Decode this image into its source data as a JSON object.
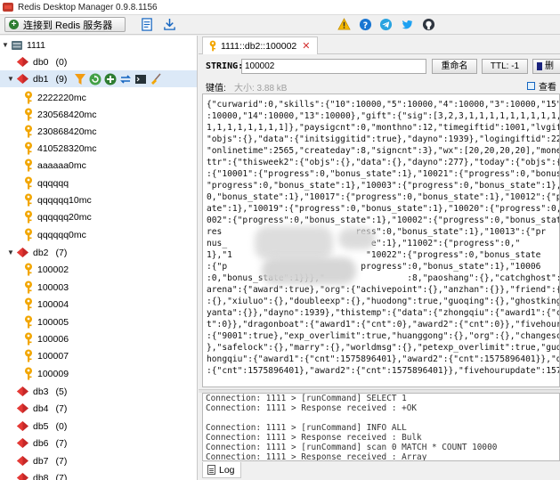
{
  "window": {
    "title": "Redis Desktop Manager 0.9.8.1156"
  },
  "toolbar": {
    "connect_label": "连接到 Redis 服务器",
    "icons": [
      "import-icon",
      "export-icon",
      "warning-icon",
      "help-icon",
      "telegram-icon",
      "twitter-icon",
      "github-icon"
    ]
  },
  "tree": {
    "server": {
      "name": "1111"
    },
    "databases_top": [
      {
        "name": "db0",
        "count": "(0)"
      },
      {
        "name": "db1",
        "count": "(9)"
      }
    ],
    "db1_keys": [
      "2222220mc",
      "230568420mc",
      "230868420mc",
      "410528320mc",
      "aaaaaa0mc",
      "qqqqqq",
      "qqqqqq10mc",
      "qqqqqq20mc",
      "qqqqqq0mc"
    ],
    "db2": {
      "name": "db2",
      "count": "(7)"
    },
    "db2_keys": [
      "100002",
      "100003",
      "100004",
      "100005",
      "100006",
      "100007",
      "100009"
    ],
    "databases_bottom": [
      {
        "name": "db3",
        "count": "(5)"
      },
      {
        "name": "db4",
        "count": "(7)"
      },
      {
        "name": "db5",
        "count": "(0)"
      },
      {
        "name": "db6",
        "count": "(7)"
      },
      {
        "name": "db7",
        "count": "(7)"
      },
      {
        "name": "db8",
        "count": "(7)"
      }
    ],
    "colors": {
      "db_icon": "#c62828",
      "key_icon": "#f2a600",
      "selected_row": "#dce9f7"
    }
  },
  "tab": {
    "label": "1111::db2::100002"
  },
  "key": {
    "type_label": "STRING:",
    "name": "100002",
    "rename_label": "重命名",
    "ttl_label": "TTL: -1",
    "delete_label": "删"
  },
  "value": {
    "label": "键值:",
    "size": "大小: 3.88 kB",
    "view_label": "查看",
    "lines": [
      "{\"curwarid\":0,\"skills\":{\"10\":10000,\"5\":10000,\"4\":10000,\"3\":10000,\"15\":1000",
      ":10000,\"14\":10000,\"13\":10000},\"gift\":{\"sig\":[3,2,3,1,1,1,1,1,1,1,1,1,1,1,",
      "1,1,1,1,1,1,1,1]},\"paysigcnt\":0,\"monthno\":12,\"timegiftid\":1001,\"lvgiftid\":2",
      "\"objs\":{},\"data\":{\"initsiggitid\":true},\"dayno\":1939},\"logingiftid\":2203,\"sig",
      "\"onlinetime\":2565,\"createday\":8,\"signcnt\":3},\"wx\":[20,20,20,20],\"money\":33",
      "ttr\":{\"thisweek2\":{\"objs\":{},\"data\":{},\"dayno\":277},\"today\":{\"objs\":{\"huodon",
      ":{\"10001\":{\"progress\":0,\"bonus_state\":1},\"10021\":{\"progress\":0,\"bonus_state\"",
      "\"progress\":0,\"bonus_state\":1},\"10003\":{\"progress\":0,\"bonus_state\":1},\"10014\"",
      "0,\"bonus_state\":1},\"10017\":{\"progress\":0,\"bonus_state\":1},\"10012\":{\"progress",
      "ate\":1},\"10019\":{\"progress\":0,\"bonus_state\":1},\"10020\":{\"progress\":0,\"bonus_",
      "002\":{\"progress\":0,\"bonus_state\":1},\"10002\":{\"progress\":0,\"bonus_state\":1},\"",
      "res                          ress\":0,\"bonus_state\":1},\"10013\":{\"pr",
      "nus_                            e\":1},\"11002\":{\"progress\":0,\"",
      "1},\"1                          \"10022\":{\"progress\":0,\"bonus_state",
      ":{\"p                          progress\":0,\"bonus_state\":1},\"10006",
      ":0,\"bonus_state\":1}}},\"                :8,\"paoshang\":{},\"catchghost\":{},\"t",
      "arena\":{\"award\":true},\"org\":{\"achivepoint\":{},\"anzhan\":{}},\"friend\":{},\"keju",
      ":{},\"xiuluo\":{},\"doubleexp\":{},\"huodong\":true,\"guoqing\":{},\"ghostking\":{},\"a",
      "yanta\":{}},\"dayno\":1939},\"thistemp\":{\"data\":{\"zhongqiu\":{\"award1\":{\"cnt\":0},",
      "t\":0}},\"dragonboat\":{\"award1\":{\"cnt\":0},\"award2\":{\"cnt\":0}},\"fivehourupdate\"",
      ":{\"9001\":true},\"exp_overlimit\":true,\"huanggong\":{},\"org\":{},\"changescene\":tr",
      "},\"safelock\":{},\"marry\":{},\"worldmsg\":{},\"petexp_overlimit\":true,\"guoqing\":{",
      "hongqiu\":{\"award1\":{\"cnt\":1575896401},\"award2\":{\"cnt\":1575896401}},\"dragonbo",
      ":{\"cnt\":1575896401},\"award2\":{\"cnt\":1575896401}},\"fivehourupdate\":15764436"
    ]
  },
  "log": {
    "tab_label": "Log",
    "lines": [
      "Connection: 1111 > [runCommand] SELECT 1",
      "Connection: 1111 > Response received : +OK",
      "",
      "Connection: 1111 > [runCommand] INFO ALL",
      "Connection: 1111 > Response received : Bulk",
      "Connection: 1111 > [runCommand] scan 0 MATCH * COUNT 10000",
      "Connection: 1111 > Response received : Array"
    ]
  }
}
